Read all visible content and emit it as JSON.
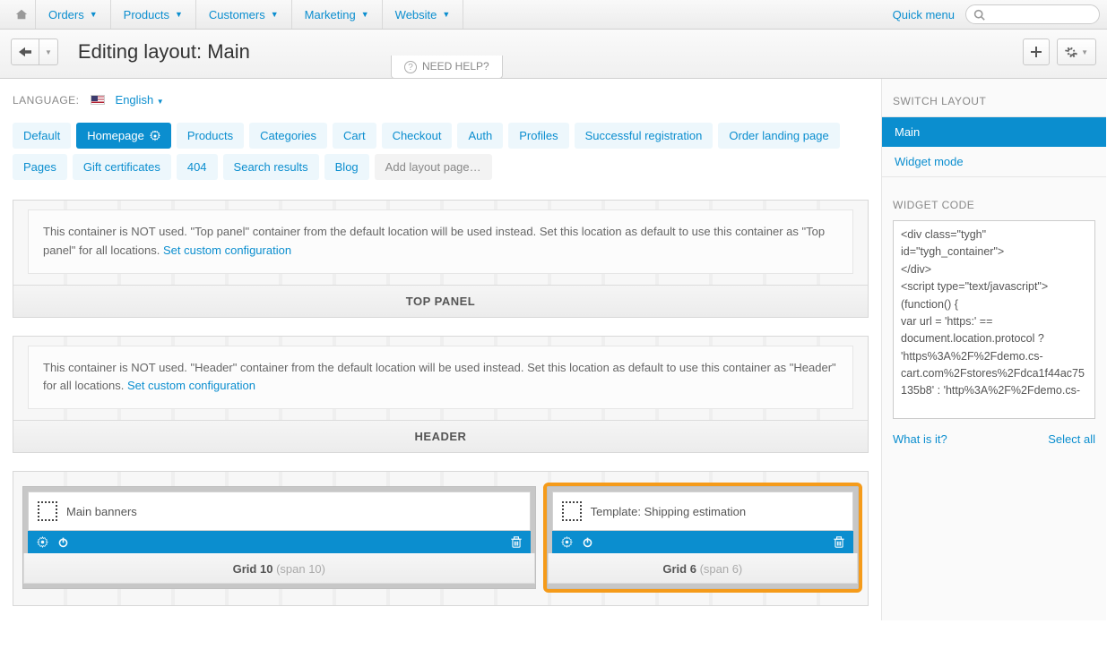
{
  "topnav": {
    "items": [
      "Orders",
      "Products",
      "Customers",
      "Marketing",
      "Website"
    ],
    "quick_label": "Quick menu"
  },
  "page": {
    "title": "Editing layout: Main",
    "help_label": "NEED HELP?"
  },
  "language": {
    "label": "LANGUAGE:",
    "current": "English"
  },
  "layout_tabs": {
    "row1": [
      "Default",
      "Homepage",
      "Products",
      "Categories",
      "Cart",
      "Checkout",
      "Auth",
      "Profiles",
      "Successful registration",
      "Order landing page"
    ],
    "row2": [
      "Pages",
      "Gift certificates",
      "404",
      "Search results",
      "Blog",
      "Add layout page…"
    ],
    "active": "Homepage"
  },
  "containers": {
    "top_panel": {
      "notice_prefix": "This container is NOT used. \"Top panel\" container from the default location will be used instead. Set this location as default to use this container as \"Top panel\" for all locations. ",
      "link": "Set custom configuration",
      "title": "TOP PANEL"
    },
    "header": {
      "notice_prefix": "This container is NOT used. \"Header\" container from the default location will be used instead. Set this location as default to use this container as \"Header\" for all locations. ",
      "link": "Set custom configuration",
      "title": "HEADER"
    }
  },
  "grids": {
    "col1": {
      "block_title": "Main banners",
      "label": "Grid 10",
      "span": "(span 10)"
    },
    "col2": {
      "block_title": "Template: Shipping estimation",
      "label": "Grid 6",
      "span": "(span 6)"
    }
  },
  "sidebar": {
    "switch_title": "SWITCH LAYOUT",
    "items": [
      {
        "label": "Main",
        "active": true
      },
      {
        "label": "Widget mode",
        "active": false
      }
    ],
    "widget_title": "WIDGET CODE",
    "code": "<div class=\"tygh\" id=\"tygh_container\">\n</div>\n<script type=\"text/javascript\">\n(function() {\nvar url = 'https:' == document.location.protocol ? 'https%3A%2F%2Fdemo.cs-cart.com%2Fstores%2Fdca1f44ac75135b8' : 'http%3A%2F%2Fdemo.cs-",
    "what_label": "What is it?",
    "select_label": "Select all"
  }
}
